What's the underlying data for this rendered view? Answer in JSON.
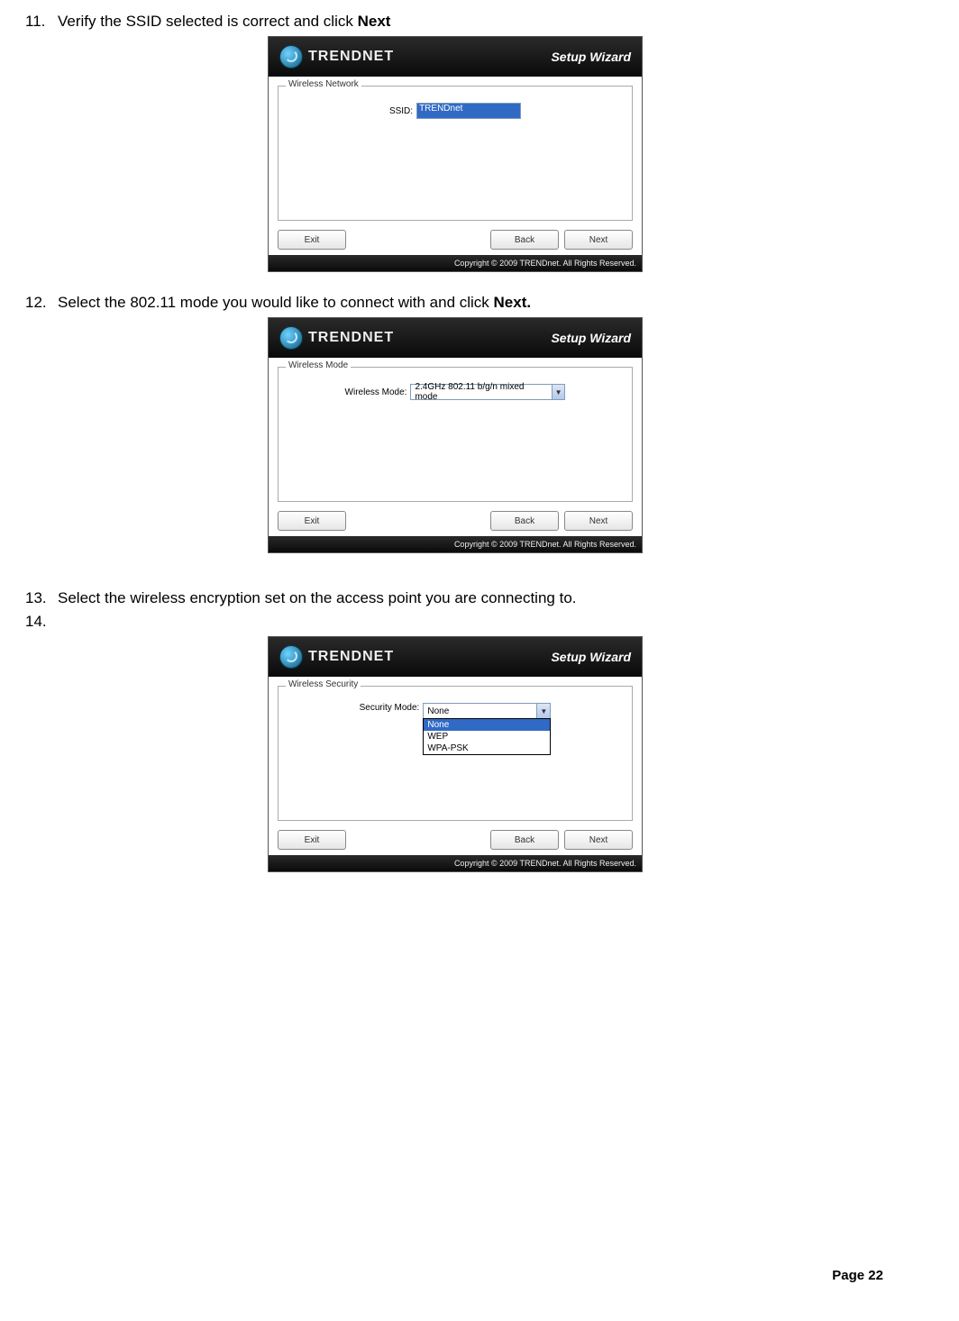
{
  "steps": {
    "s11": {
      "num": "11.",
      "text_before": "Verify the SSID selected is correct and click ",
      "text_bold": "Next"
    },
    "s12": {
      "num": "12.",
      "text_before": "Select the 802.11 mode you would like to connect with and click ",
      "text_bold": "Next."
    },
    "s13": {
      "num": "13.",
      "text_before": "Select the wireless encryption set on the access point you are connecting to.",
      "text_bold": ""
    },
    "s14": {
      "num": "14.",
      "text_before": "",
      "text_bold": ""
    }
  },
  "brand": "TRENDNET",
  "wizard_title": "Setup Wizard",
  "footer": "Copyright © 2009 TRENDnet. All Rights Reserved.",
  "buttons": {
    "exit": "Exit",
    "back": "Back",
    "next": "Next"
  },
  "panel1": {
    "legend": "Wireless Network",
    "label": "SSID:",
    "value": "TRENDnet"
  },
  "panel2": {
    "legend": "Wireless Mode",
    "label": "Wireless Mode:",
    "value": "2.4GHz 802.11 b/g/n mixed mode"
  },
  "panel3": {
    "legend": "Wireless Security",
    "label": "Security Mode:",
    "selected": "None",
    "options": [
      "None",
      "WEP",
      "WPA-PSK"
    ]
  },
  "page_label": "Page 22"
}
